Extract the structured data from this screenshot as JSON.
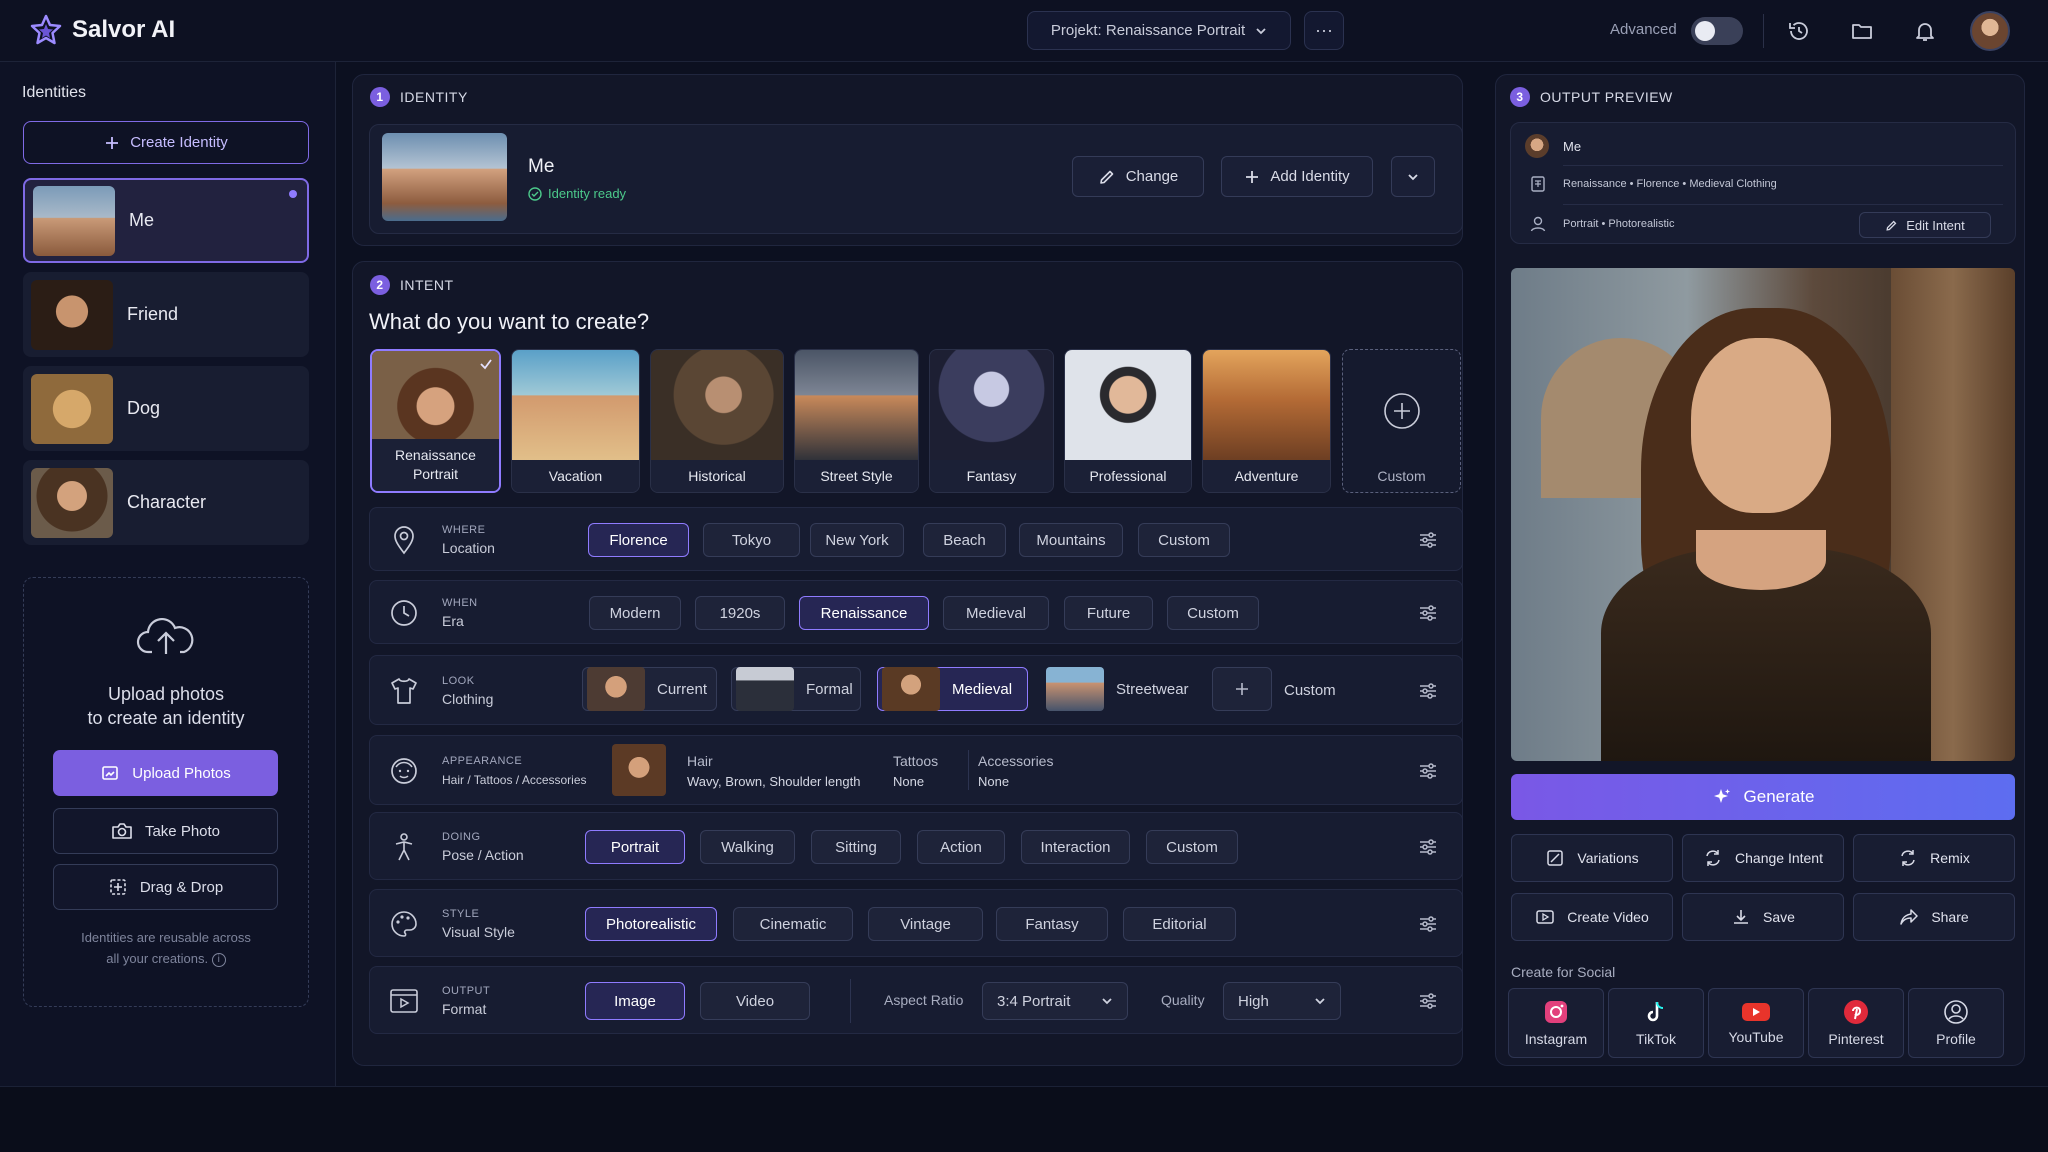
{
  "app": {
    "name": "Salvor AI"
  },
  "header": {
    "project_label": "Projekt: Renaissance Portrait",
    "more": "···",
    "advanced_label": "Advanced",
    "advanced_on": false
  },
  "sidebar": {
    "title": "Identities",
    "create_label": "Create Identity",
    "items": [
      {
        "label": "Me",
        "selected": true
      },
      {
        "label": "Friend",
        "selected": false
      },
      {
        "label": "Dog",
        "selected": false
      },
      {
        "label": "Character",
        "selected": false
      }
    ],
    "upload": {
      "line1": "Upload photos",
      "line2": "to create an identity",
      "upload_btn": "Upload Photos",
      "take_btn": "Take Photo",
      "drag_btn": "Drag & Drop",
      "note1": "Identities are reusable across",
      "note2": "all your creations."
    }
  },
  "identity": {
    "step": "1",
    "heading": "IDENTITY",
    "name": "Me",
    "status": "Identity ready",
    "change_label": "Change",
    "add_label": "Add Identity"
  },
  "intent": {
    "step": "2",
    "heading": "INTENT",
    "question": "What do you want to create?",
    "cards": [
      {
        "line1": "Renaissance",
        "line2": "Portrait"
      },
      {
        "label": "Vacation"
      },
      {
        "label": "Historical"
      },
      {
        "label": "Street Style"
      },
      {
        "label": "Fantasy"
      },
      {
        "label": "Professional"
      },
      {
        "label": "Adventure"
      },
      {
        "label": "Custom"
      }
    ],
    "rows": {
      "where": {
        "k1": "WHERE",
        "k2": "Location",
        "options": [
          "Florence",
          "Tokyo",
          "New York",
          "Beach",
          "Mountains",
          "Custom"
        ],
        "selected": "Florence"
      },
      "when": {
        "k1": "WHEN",
        "k2": "Era",
        "options": [
          "Modern",
          "1920s",
          "Renaissance",
          "Medieval",
          "Future",
          "Custom"
        ],
        "selected": "Renaissance"
      },
      "look": {
        "k1": "LOOK",
        "k2": "Clothing",
        "options": [
          "Current",
          "Formal",
          "Medieval",
          "Streetwear",
          "Custom"
        ],
        "selected": "Medieval"
      },
      "appearance": {
        "k1": "APPEARANCE",
        "k2": "Hair / Tattoos / Accessories",
        "hair_label": "Hair",
        "hair_value": "Wavy, Brown, Shoulder length",
        "tattoos_label": "Tattoos",
        "tattoos_value": "None",
        "acc_label": "Accessories",
        "acc_value": "None"
      },
      "doing": {
        "k1": "DOING",
        "k2": "Pose / Action",
        "options": [
          "Portrait",
          "Walking",
          "Sitting",
          "Action",
          "Interaction",
          "Custom"
        ],
        "selected": "Portrait"
      },
      "style": {
        "k1": "STYLE",
        "k2": "Visual Style",
        "options": [
          "Photorealistic",
          "Cinematic",
          "Vintage",
          "Fantasy",
          "Editorial"
        ],
        "selected": "Photorealistic"
      },
      "output": {
        "k1": "OUTPUT",
        "k2": "Format",
        "options": [
          "Image",
          "Video"
        ],
        "selected": "Image",
        "aspect_label": "Aspect Ratio",
        "aspect_value": "3:4  Portrait",
        "quality_label": "Quality",
        "quality_value": "High"
      }
    }
  },
  "preview": {
    "step": "3",
    "heading": "OUTPUT PREVIEW",
    "identity": "Me",
    "meta1": "Renaissance  •  Florence  •  Medieval Clothing",
    "meta2": "Portrait  •  Photorealistic",
    "edit_label": "Edit Intent",
    "generate_label": "Generate",
    "actions": [
      "Variations",
      "Change Intent",
      "Remix",
      "Create Video",
      "Save",
      "Share"
    ],
    "social_title": "Create for Social",
    "social": [
      "Instagram",
      "TikTok",
      "YouTube",
      "Pinterest",
      "Profile"
    ]
  },
  "colors": {
    "accent": "#7b5fe0",
    "bg": "#0c1020",
    "panel": "#121628"
  }
}
